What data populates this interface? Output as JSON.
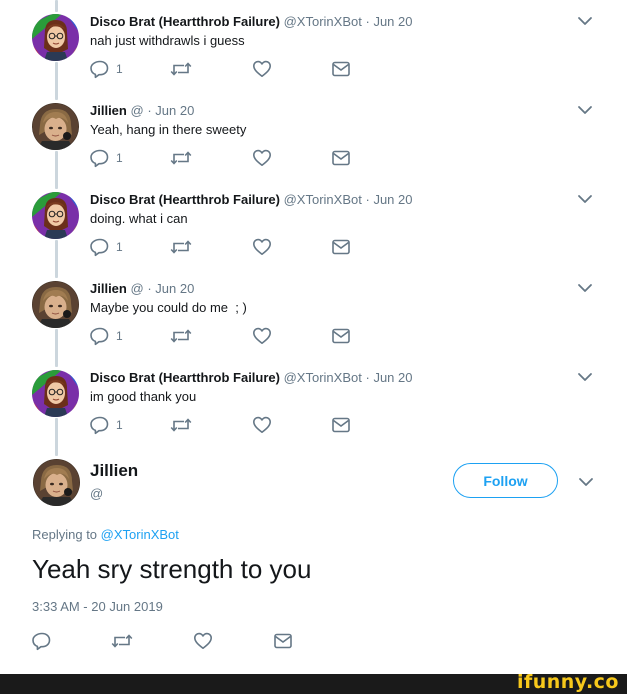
{
  "colors": {
    "link": "#1da1f2",
    "text": "#14171a",
    "muted": "#657786",
    "thread_line": "#ccd6dd",
    "footer_bg": "#1a1a1a",
    "watermark": "#f7c81b"
  },
  "icons": {
    "reply": "speech-bubble-icon",
    "retweet": "retweet-arrows-icon",
    "like": "heart-icon",
    "dm": "envelope-icon",
    "menu": "chevron-down-icon"
  },
  "thread": [
    {
      "name": "Disco Brat (Heartthrob Failure)",
      "handle": "@XTorinXBot",
      "sep": "·",
      "time": "Jun 20",
      "text": "nah just withdrawls i guess",
      "reply_count": "1"
    },
    {
      "name": "Jillien",
      "handle": "@",
      "sep": "·",
      "time": "Jun 20",
      "text": "Yeah, hang in there sweety",
      "reply_count": "1"
    },
    {
      "name": "Disco Brat (Heartthrob Failure)",
      "handle": "@XTorinXBot",
      "sep": "·",
      "time": "Jun 20",
      "text": "doing. what i can",
      "reply_count": "1"
    },
    {
      "name": "Jillien",
      "handle": "@",
      "sep": "·",
      "time": "Jun 20",
      "text": "Maybe you could do me  ; )",
      "reply_count": "1"
    },
    {
      "name": "Disco Brat (Heartthrob Failure)",
      "handle": "@XTorinXBot",
      "sep": "·",
      "time": "Jun 20",
      "text": "im good thank you",
      "reply_count": "1"
    }
  ],
  "main_tweet": {
    "name": "Jillien",
    "handle": "@",
    "follow_label": "Follow",
    "replying_prefix": "Replying to ",
    "replying_to": "@XTorinXBot",
    "text": "Yeah sry strength to you",
    "timestamp": "3:33 AM - 20 Jun 2019"
  },
  "watermark": "ifunny.co"
}
